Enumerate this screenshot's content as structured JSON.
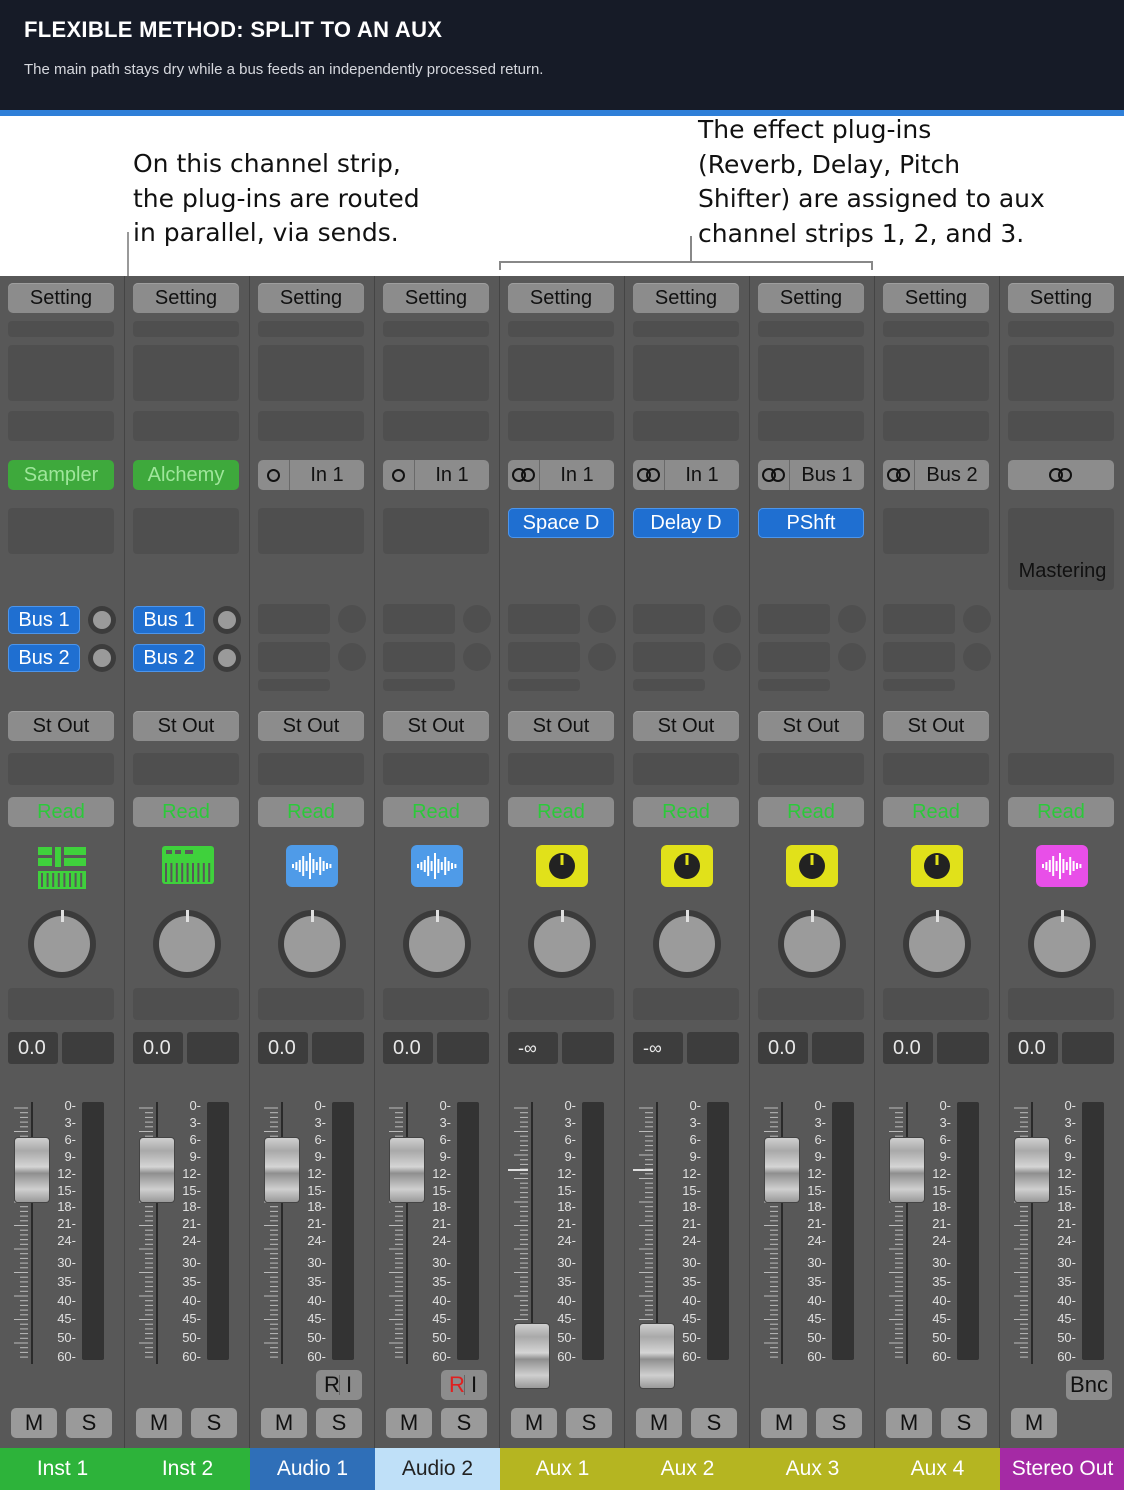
{
  "header": {
    "title": "FLEXIBLE METHOD: SPLIT TO AN AUX",
    "subtitle": "The main path stays dry while a bus feeds an independently processed return."
  },
  "callouts": {
    "left": "On this channel strip,\nthe plug-ins are routed\nin parallel, via sends.",
    "right": "The effect plug-ins\n(Reverb, Delay, Pitch\nShifter) are assigned to aux\nchannel strips 1, 2, and 3."
  },
  "colors": {
    "header_bg": "#161b27",
    "accent_line": "#2f7fd8",
    "plugin_blue": "#1f6fd1",
    "read_green": "#2cc93a"
  },
  "strips": [
    {
      "name": "Inst 1",
      "name_bg": "#2db33a",
      "name_color": "#ffffff",
      "setting": "Setting",
      "instrument": "Sampler",
      "sends": [
        "Bus 1",
        "Bus 2"
      ],
      "output": "St Out",
      "automation": "Read",
      "icon": "sampler-icon",
      "icon_color": "#3fd13c",
      "gain": "0.0",
      "fader_db": 0,
      "mute": "M",
      "solo": "S"
    },
    {
      "name": "Inst 2",
      "name_bg": "#2db33a",
      "name_color": "#ffffff",
      "setting": "Setting",
      "instrument": "Alchemy",
      "sends": [
        "Bus 1",
        "Bus 2"
      ],
      "output": "St Out",
      "automation": "Read",
      "icon": "synth-keyboard-icon",
      "icon_color": "#3fd13c",
      "gain": "0.0",
      "fader_db": 0,
      "mute": "M",
      "solo": "S"
    },
    {
      "name": "Audio 1",
      "name_bg": "#2f6fb8",
      "name_color": "#ffffff",
      "setting": "Setting",
      "input_symbol": "mono",
      "input": "In 1",
      "output": "St Out",
      "automation": "Read",
      "icon": "waveform-icon",
      "icon_color": "#4f9be8",
      "gain": "0.0",
      "fader_db": 0,
      "record": "R",
      "input_monitor": "I",
      "record_active": false,
      "mute": "M",
      "solo": "S"
    },
    {
      "name": "Audio 2",
      "name_bg": "#bfe0f8",
      "name_color": "#222222",
      "setting": "Setting",
      "input_symbol": "mono",
      "input": "In 1",
      "output": "St Out",
      "automation": "Read",
      "icon": "waveform-icon",
      "icon_color": "#4f9be8",
      "gain": "0.0",
      "fader_db": 0,
      "record": "R",
      "input_monitor": "I",
      "record_active": true,
      "mute": "M",
      "solo": "S"
    },
    {
      "name": "Aux 1",
      "name_bg": "#b5b521",
      "name_color": "#ffffff",
      "setting": "Setting",
      "input_symbol": "stereo",
      "input": "In 1",
      "plugin": "Space D",
      "output": "St Out",
      "automation": "Read",
      "icon": "aux-knob-icon",
      "icon_color": "#e1e11a",
      "gain": "-∞",
      "fader_db": "-inf",
      "mute": "M",
      "solo": "S"
    },
    {
      "name": "Aux 2",
      "name_bg": "#b5b521",
      "name_color": "#ffffff",
      "setting": "Setting",
      "input_symbol": "stereo",
      "input": "In 1",
      "plugin": "Delay D",
      "output": "St Out",
      "automation": "Read",
      "icon": "aux-knob-icon",
      "icon_color": "#e1e11a",
      "gain": "-∞",
      "fader_db": "-inf",
      "mute": "M",
      "solo": "S"
    },
    {
      "name": "Aux 3",
      "name_bg": "#b5b521",
      "name_color": "#ffffff",
      "setting": "Setting",
      "input_symbol": "stereo",
      "input": "Bus 1",
      "plugin": "PShft",
      "output": "St Out",
      "automation": "Read",
      "icon": "aux-knob-icon",
      "icon_color": "#e1e11a",
      "gain": "0.0",
      "fader_db": 0,
      "mute": "M",
      "solo": "S"
    },
    {
      "name": "Aux 4",
      "name_bg": "#b5b521",
      "name_color": "#ffffff",
      "setting": "Setting",
      "input_symbol": "stereo",
      "input": "Bus 2",
      "output": "St Out",
      "automation": "Read",
      "icon": "aux-knob-icon",
      "icon_color": "#e1e11a",
      "gain": "0.0",
      "fader_db": 0,
      "mute": "M",
      "solo": "S"
    },
    {
      "name": "Stereo Out",
      "name_bg": "#a52aa5",
      "name_color": "#ffffff",
      "setting": "Setting",
      "input_symbol": "stereo",
      "input": "",
      "mastering": "Mastering",
      "automation": "Read",
      "icon": "waveform-icon",
      "icon_color": "#e84fe8",
      "gain": "0.0",
      "fader_db": 0,
      "bounce": "Bnc",
      "mute": "M"
    }
  ],
  "meter_scale": [
    "0",
    "3",
    "6",
    "9",
    "12",
    "15",
    "18",
    "21",
    "24",
    "30",
    "35",
    "40",
    "45",
    "50",
    "60"
  ]
}
